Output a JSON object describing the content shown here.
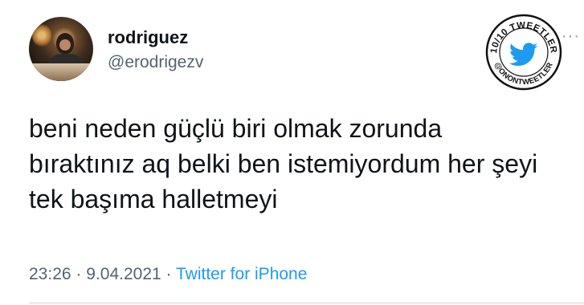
{
  "user": {
    "display_name": "rodriguez",
    "handle": "@erodrigezv"
  },
  "tweet": {
    "lines": [
      "beni neden güçlü biri olmak zorunda",
      "bıraktınız aq belki ben istemiyordum her şeyi",
      "tek başıma halletmeyi"
    ],
    "time": "23:26",
    "separator1": "·",
    "date": "9.04.2021",
    "separator2": "·",
    "source": "Twitter for iPhone"
  },
  "watermark": {
    "top_text": "10/10 TWEETLER",
    "bottom_text": "@ONONTWEETLER",
    "icon": "twitter-bird-icon"
  },
  "more_menu": {
    "icon": "more-options-icon",
    "glyph": "···"
  },
  "colors": {
    "text": "#0f1419",
    "secondary": "#536471",
    "link": "#1d9bf0",
    "bird": "#1d9bf0"
  }
}
